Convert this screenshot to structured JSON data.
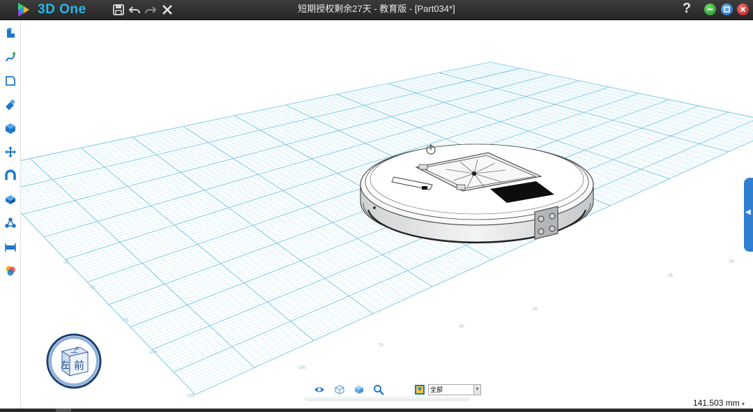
{
  "app": {
    "name": "3D One",
    "title": "短期授权剩余27天 - 教育版 - [Part034*]",
    "help_label": "?"
  },
  "titlebar_actions": [
    {
      "name": "save-icon"
    },
    {
      "name": "undo-icon"
    },
    {
      "name": "redo-icon"
    },
    {
      "name": "close-icon"
    }
  ],
  "window_controls": [
    {
      "name": "minimize-button",
      "color": "#2eaa2e"
    },
    {
      "name": "restore-button",
      "color": "#2a7fd6"
    },
    {
      "name": "close-window-button",
      "color": "#d43030"
    }
  ],
  "left_toolbar": [
    "basic-solid-icon",
    "sketch-icon",
    "sketch-edit-icon",
    "special-function-icon",
    "combine-icon",
    "move-icon",
    "magnet-icon",
    "pattern-icon",
    "assembly-icon",
    "measure-icon",
    "color-palette-icon"
  ],
  "view_cube": {
    "top_label": "上",
    "left_label": "左",
    "front_label": "前"
  },
  "bottom_toolbar": {
    "icons": [
      "eye-icon",
      "wireframe-cube-icon",
      "shaded-cube-icon",
      "zoom-icon",
      "filter-icon"
    ],
    "filter_value": "全部"
  },
  "grid_labels": [
    "-25",
    "-50",
    "-75",
    "-100",
    "-125",
    "-100",
    "-75",
    "-50",
    "-25",
    "25",
    "50"
  ],
  "measurement": {
    "value": "141.503 mm"
  },
  "colors": {
    "accent": "#28b8e6",
    "grid": "#7fd0ea",
    "titlebar": "#2e2e2e",
    "panel_tab": "#2f7fd3"
  }
}
